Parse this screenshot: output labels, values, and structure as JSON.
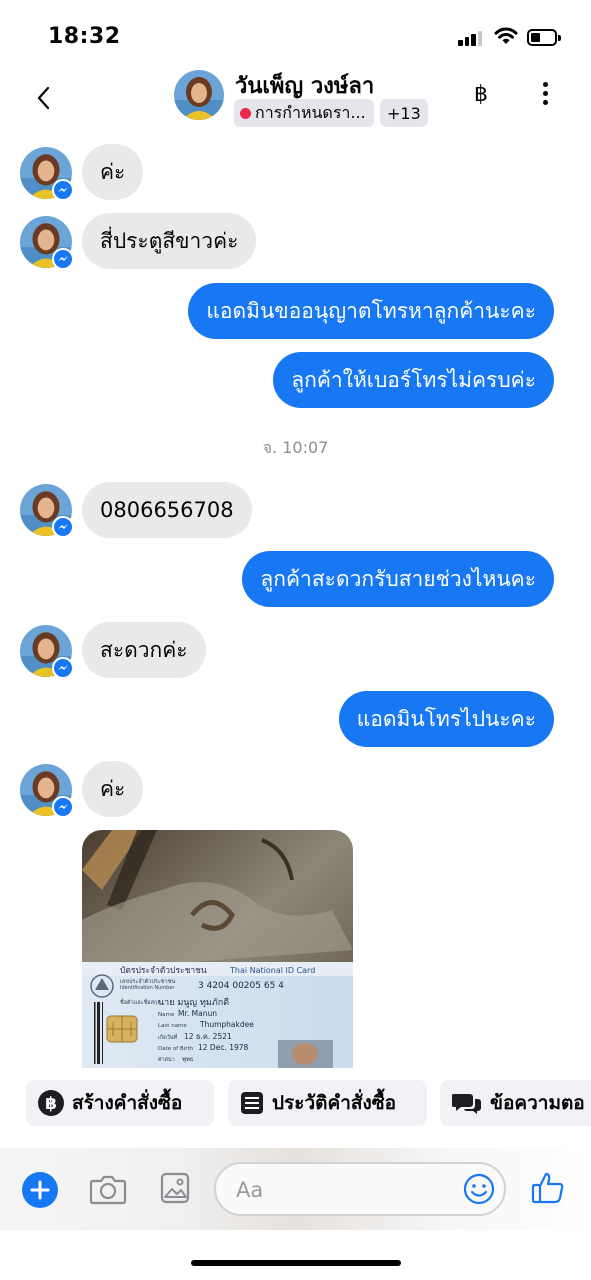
{
  "status_bar": {
    "time": "18:32"
  },
  "header": {
    "contact_name": "วันเพ็ญ วงษ์ลา",
    "label_text": "การกำหนดรา...",
    "label_more": "+13",
    "currency_icon": "฿"
  },
  "messages": [
    {
      "direction": "in",
      "text": "ค่ะ"
    },
    {
      "direction": "in",
      "text": "สี่ประตูสีขาวค่ะ"
    },
    {
      "direction": "out",
      "text": "แอดมินขออนุญาตโทรหาลูกค้านะคะ"
    },
    {
      "direction": "out",
      "text": "ลูกค้าให้เบอร์โทรไม่ครบค่ะ"
    },
    {
      "direction": "in",
      "text": "0806656708"
    },
    {
      "direction": "out",
      "text": "ลูกค้าสะดวกรับสายช่วงไหนคะ"
    },
    {
      "direction": "in",
      "text": "สะดวกค่ะ"
    },
    {
      "direction": "out",
      "text": "แอดมินโทรไปนะคะ"
    },
    {
      "direction": "in",
      "text": "ค่ะ"
    }
  ],
  "timestamp": "จ. 10:07",
  "id_card": {
    "title_th": "บัตรประจำตัวประชาชน",
    "title_en": "Thai National ID Card",
    "id_label": "เลขประจำตัวประชาชน",
    "id_label_en": "Identification Number",
    "id_number": "3 4204 00205 65 4",
    "name_label": "ชื่อตัวและชื่อสกุล",
    "name_th": "นาย มนูญ ทุมภักดี",
    "name_en_label": "Name",
    "name_en": "Mr. Manun",
    "last_name_label": "Last name",
    "last_name_en": "Thumphakdee",
    "dob_label_th": "เกิดวันที่",
    "dob_th": "12 ธ.ค. 2521",
    "dob_label_en": "Date of Birth",
    "dob_en": "12 Dec. 1978",
    "religion_label": "ศาสนา",
    "religion": "พุทธ"
  },
  "quick_actions": [
    {
      "label": "สร้างคำสั่งซื้อ",
      "icon": "baht-circle-icon"
    },
    {
      "label": "ประวัติคำสั่งซื้อ",
      "icon": "order-list-icon"
    },
    {
      "label": "ข้อความตอ",
      "icon": "chat-bubbles-icon"
    }
  ],
  "composer": {
    "placeholder": "Aa"
  },
  "colors": {
    "accent": "#1877f2",
    "incoming_bubble": "#e9e9eb",
    "label_dot": "#f02849"
  }
}
